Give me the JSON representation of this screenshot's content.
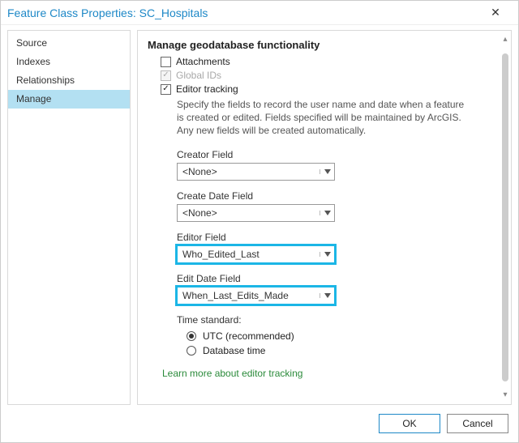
{
  "window": {
    "title": "Feature Class Properties: SC_Hospitals"
  },
  "nav": {
    "items": [
      {
        "label": "Source",
        "selected": false
      },
      {
        "label": "Indexes",
        "selected": false
      },
      {
        "label": "Relationships",
        "selected": false
      },
      {
        "label": "Manage",
        "selected": true
      }
    ]
  },
  "content": {
    "section_title": "Manage geodatabase functionality",
    "checks": {
      "attachments": {
        "label": "Attachments",
        "checked": false,
        "enabled": true
      },
      "global_ids": {
        "label": "Global IDs",
        "checked": true,
        "enabled": false
      },
      "editor_tracking": {
        "label": "Editor tracking",
        "checked": true,
        "enabled": true
      }
    },
    "description": "Specify the fields to record the user name and date when a feature is created or edited. Fields specified will be maintained by ArcGIS. Any new fields will be created automatically.",
    "fields": {
      "creator": {
        "label": "Creator Field",
        "value": "<None>",
        "highlight": false
      },
      "createDate": {
        "label": "Create Date Field",
        "value": "<None>",
        "highlight": false
      },
      "editor": {
        "label": "Editor Field",
        "value": "Who_Edited_Last",
        "highlight": true
      },
      "editDate": {
        "label": "Edit Date Field",
        "value": "When_Last_Edits_Made",
        "highlight": true
      }
    },
    "time_standard": {
      "label": "Time standard:",
      "options": {
        "utc": {
          "label": "UTC (recommended)",
          "selected": true
        },
        "database": {
          "label": "Database time",
          "selected": false
        }
      }
    },
    "link": "Learn more about editor tracking"
  },
  "footer": {
    "ok": "OK",
    "cancel": "Cancel"
  }
}
